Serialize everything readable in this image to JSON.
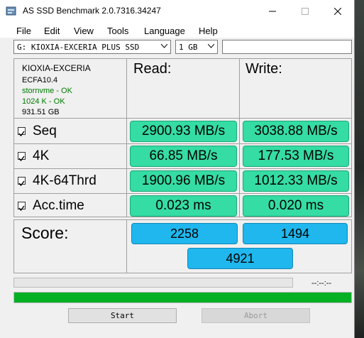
{
  "window": {
    "title": "AS SSD Benchmark 2.0.7316.34247"
  },
  "menu": [
    "File",
    "Edit",
    "View",
    "Tools",
    "Language",
    "Help"
  ],
  "drive_select": {
    "value": "G: KIOXIA-EXCERIA PLUS SSD"
  },
  "size_select": {
    "value": "1 GB"
  },
  "name_input": {
    "value": ""
  },
  "info": {
    "model": "KIOXIA-EXCERIA",
    "firmware": "ECFA10.4",
    "driver": "stornvme - OK",
    "alignment": "1024 K - OK",
    "capacity": "931.51 GB"
  },
  "headers": {
    "read": "Read:",
    "write": "Write:"
  },
  "rows": [
    {
      "label": "Seq",
      "read": "2900.93 MB/s",
      "write": "3038.88 MB/s",
      "checked": true
    },
    {
      "label": "4K",
      "read": "66.85 MB/s",
      "write": "177.53 MB/s",
      "checked": true
    },
    {
      "label": "4K-64Thrd",
      "read": "1900.96 MB/s",
      "write": "1012.33 MB/s",
      "checked": true
    },
    {
      "label": "Acc.time",
      "read": "0.023 ms",
      "write": "0.020 ms",
      "checked": true
    }
  ],
  "score": {
    "label": "Score:",
    "read": "2258",
    "write": "1494",
    "total": "4921"
  },
  "status": {
    "time": "--:--:--",
    "progress_fraction": 1.0
  },
  "buttons": {
    "start": "Start",
    "abort": "Abort"
  },
  "colors": {
    "result_green": "#35dca4",
    "score_blue": "#1fb7ee",
    "progress_green": "#06b025",
    "ok_text": "#007a00"
  }
}
